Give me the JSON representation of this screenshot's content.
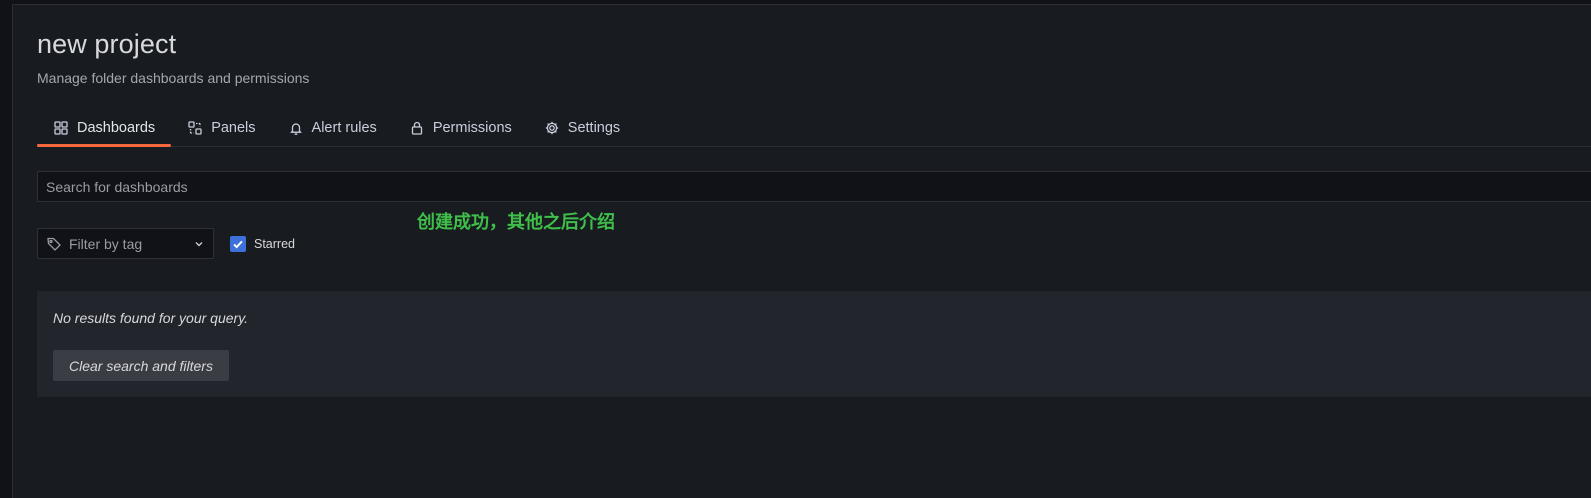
{
  "header": {
    "title": "new project",
    "subtitle": "Manage folder dashboards and permissions"
  },
  "tabs": [
    {
      "label": "Dashboards",
      "icon": "dashboards-grid-icon",
      "active": true
    },
    {
      "label": "Panels",
      "icon": "library-panels-icon",
      "active": false
    },
    {
      "label": "Alert rules",
      "icon": "bell-icon",
      "active": false
    },
    {
      "label": "Permissions",
      "icon": "lock-icon",
      "active": false
    },
    {
      "label": "Settings",
      "icon": "gear-icon",
      "active": false
    }
  ],
  "search": {
    "placeholder": "Search for dashboards",
    "value": ""
  },
  "annotation": "创建成功，其他之后介绍",
  "filters": {
    "tag_filter_label": "Filter by tag",
    "starred_label": "Starred",
    "starred_checked": true
  },
  "empty_state": {
    "message": "No results found for your query.",
    "clear_button_label": "Clear search and filters"
  },
  "colors": {
    "accent_tab": "#f5683b",
    "checkbox": "#3d71d9",
    "annotation": "#3fbf4a"
  }
}
